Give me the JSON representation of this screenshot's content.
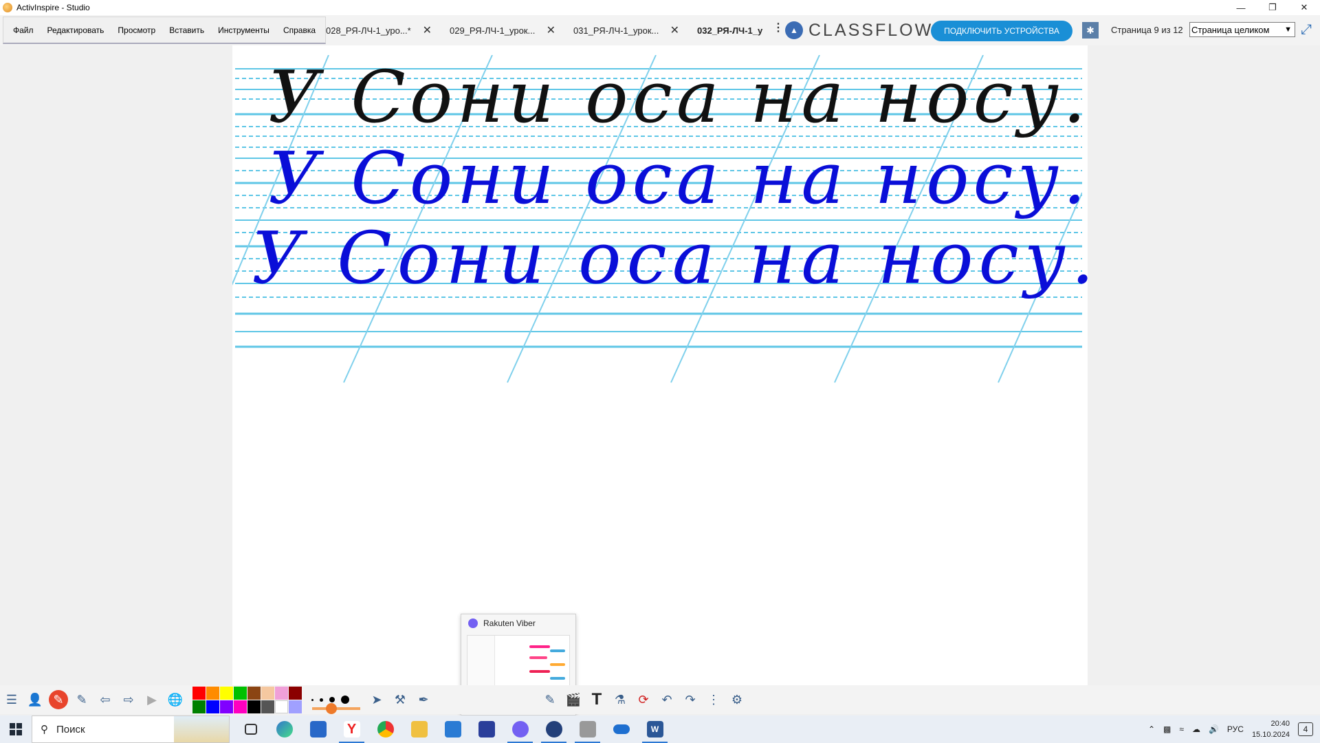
{
  "window": {
    "title": "ActivInspire - Studio"
  },
  "menu": [
    "Файл",
    "Редактировать",
    "Просмотр",
    "Вставить",
    "Инструменты",
    "Справка"
  ],
  "tabs": [
    {
      "label": "028_РЯ-ЛЧ-1_уро...*",
      "active": false
    },
    {
      "label": "029_РЯ-ЛЧ-1_урок...",
      "active": false
    },
    {
      "label": "031_РЯ-ЛЧ-1_урок...",
      "active": false
    },
    {
      "label": "032_РЯ-ЛЧ-1_у",
      "active": true
    }
  ],
  "classflow": {
    "logo": "CLASSFLOW",
    "connect_label": "ПОДКЛЮЧИТЬ УСТРОЙСТВА"
  },
  "page_counter": "Страница 9 из 12",
  "zoom": {
    "selected": "Страница целиком"
  },
  "content": {
    "line1": "У Сони оса на носу.",
    "line2": "У Сони оса на носу.",
    "line3": "У Сони оса на носу.",
    "line1_color": "#111111",
    "line2_color": "#0a0ed8",
    "line3_color": "#0a0ed8"
  },
  "guide_lines_color": "#5ec6e6",
  "popup": {
    "title": "Rakuten Viber"
  },
  "palette": [
    "#ff0000",
    "#ff8c00",
    "#ffff00",
    "#00c000",
    "#8b4513",
    "#f5c8a0",
    "#8b0000",
    "#ffffff",
    "#008000",
    "#0000ff",
    "#8000ff",
    "#ff00c0",
    "#000000",
    "#555555",
    "#ffffff",
    "#a0a0ff"
  ],
  "taskbar": {
    "search_placeholder": "Поиск",
    "language": "РУС",
    "time": "20:40",
    "date": "15.10.2024",
    "notifications": "4"
  }
}
